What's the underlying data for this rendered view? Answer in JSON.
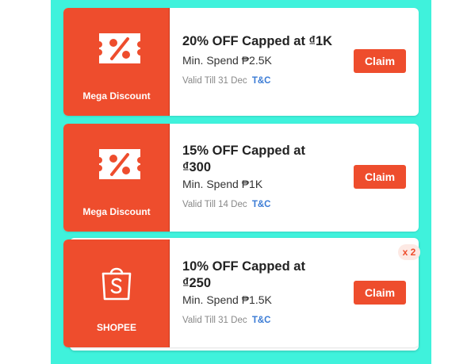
{
  "colors": {
    "panel": "#3ff2dc",
    "stub": "#ee4d2d",
    "claim_button": "#ee4d2d",
    "tc_link": "#3a7bd5"
  },
  "vouchers": [
    {
      "icon": "discount-ticket-icon",
      "stub_label": "Mega Discount",
      "title_line1": "20% OFF Capped at ₫1K",
      "title_line2": "",
      "min_spend": "Min. Spend ₱2.5K",
      "valid": "Valid Till 31 Dec",
      "tc": "T&C",
      "claim_label": "Claim"
    },
    {
      "icon": "discount-ticket-icon",
      "stub_label": "Mega Discount",
      "title_line1": "15% OFF Capped at",
      "title_line2": "₫300",
      "min_spend": "Min. Spend ₱1K",
      "valid": "Valid Till 14 Dec",
      "tc": "T&C",
      "claim_label": "Claim"
    },
    {
      "icon": "shopee-bag-icon",
      "stub_label": "SHOPEE",
      "title_line1": "10% OFF Capped at",
      "title_line2": "₫250",
      "min_spend": "Min. Spend ₱1.5K",
      "valid": "Valid Till 31 Dec",
      "tc": "T&C",
      "claim_label": "Claim",
      "quantity_badge": "x 2"
    }
  ]
}
